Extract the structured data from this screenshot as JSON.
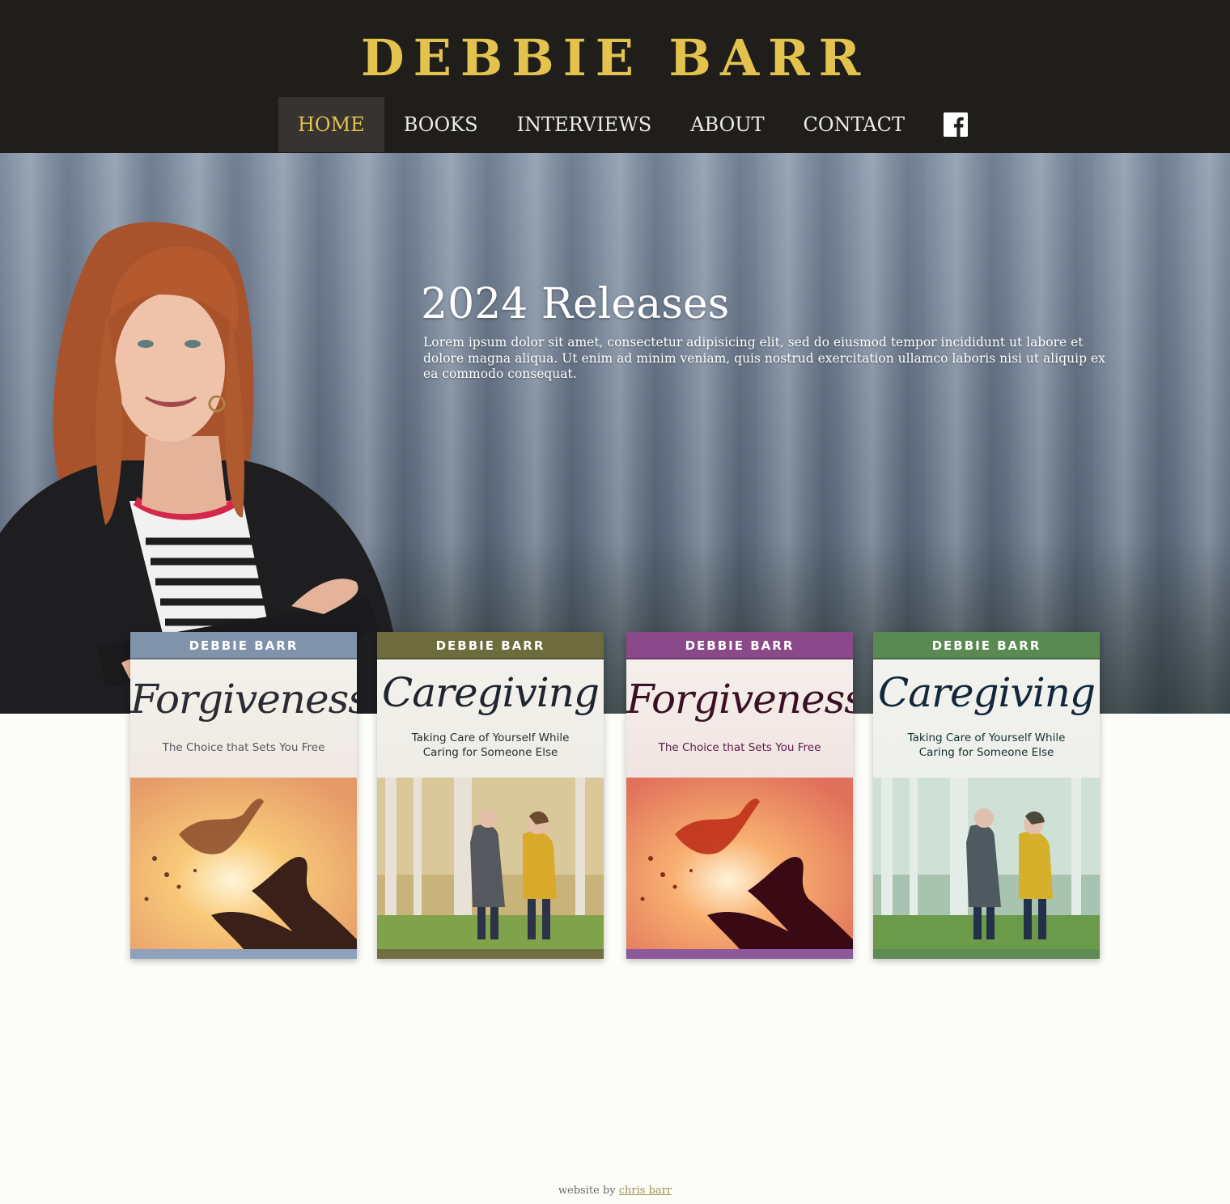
{
  "header": {
    "site_title": "DEBBIE BARR",
    "nav": [
      {
        "label": "HOME",
        "active": true
      },
      {
        "label": "BOOKS",
        "active": false
      },
      {
        "label": "INTERVIEWS",
        "active": false
      },
      {
        "label": "ABOUT",
        "active": false
      },
      {
        "label": "CONTACT",
        "active": false
      }
    ],
    "social_icon": "facebook-icon"
  },
  "hero": {
    "title": "2024 Releases",
    "text": "Lorem ipsum dolor sit amet,  consectetur adipisicing elit, sed do eiusmod tempor incididunt ut labore et dolore magna aliqua. Ut enim ad minim veniam, quis nostrud exercitation ullamco laboris nisi ut aliquip ex ea commodo consequat."
  },
  "books": [
    {
      "author": "DEBBIE BARR",
      "title": "Forgiveness",
      "subtitle": "The Choice that Sets You Free",
      "band_color": "#8093aa",
      "theme": "forgiveness-dove"
    },
    {
      "author": "DEBBIE BARR",
      "title": "Caregiving",
      "subtitle": "Taking Care of Yourself While Caring for Someone Else",
      "band_color": "#6e6b3c",
      "theme": "caregiving-walk"
    },
    {
      "author": "DEBBIE BARR",
      "title": "Forgiveness",
      "subtitle": "The Choice that Sets You Free",
      "band_color": "#8a4a8a",
      "theme": "forgiveness-dove"
    },
    {
      "author": "DEBBIE BARR",
      "title": "Caregiving",
      "subtitle": "Taking Care of Yourself While Caring for Someone Else",
      "band_color": "#5a8a52",
      "theme": "caregiving-walk"
    }
  ],
  "footer": {
    "prefix": "website by ",
    "link_text": "chris barr"
  }
}
